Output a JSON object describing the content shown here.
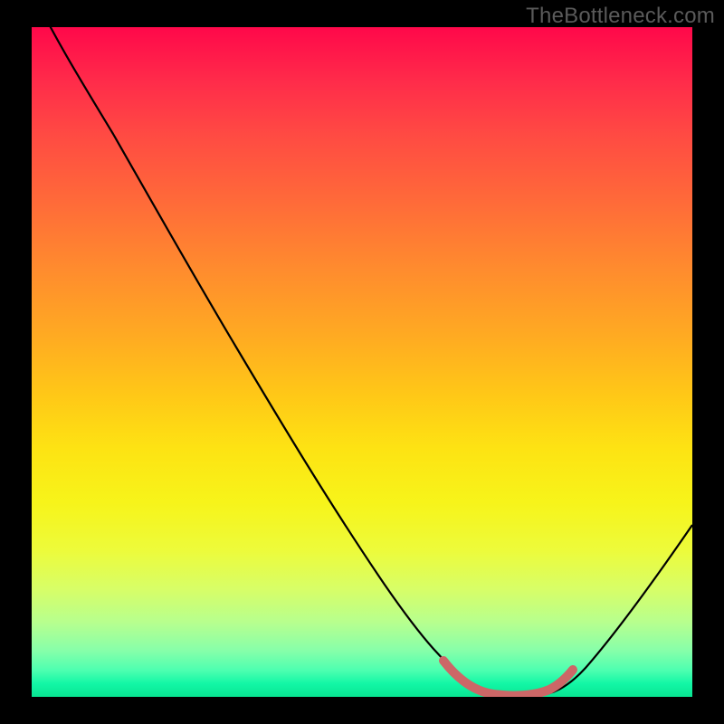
{
  "watermark": "TheBottleneck.com",
  "chart_data": {
    "type": "line",
    "title": "",
    "xlabel": "",
    "ylabel": "",
    "xlim": [
      0,
      100
    ],
    "ylim": [
      0,
      100
    ],
    "series": [
      {
        "name": "bottleneck-curve",
        "x": [
          0,
          5,
          12,
          20,
          28,
          36,
          44,
          52,
          59,
          64,
          68,
          72,
          76,
          80,
          86,
          92,
          100
        ],
        "y": [
          110,
          100,
          90,
          77,
          64,
          51,
          38,
          25,
          13,
          5,
          1,
          0,
          0,
          1,
          8,
          18,
          33
        ]
      },
      {
        "name": "highlight-band",
        "x": [
          63,
          67,
          72,
          77,
          81
        ],
        "y": [
          5.5,
          1.2,
          0,
          0.5,
          4
        ]
      }
    ],
    "colors": {
      "curve": "#000000",
      "highlight": "#cc6666"
    }
  }
}
